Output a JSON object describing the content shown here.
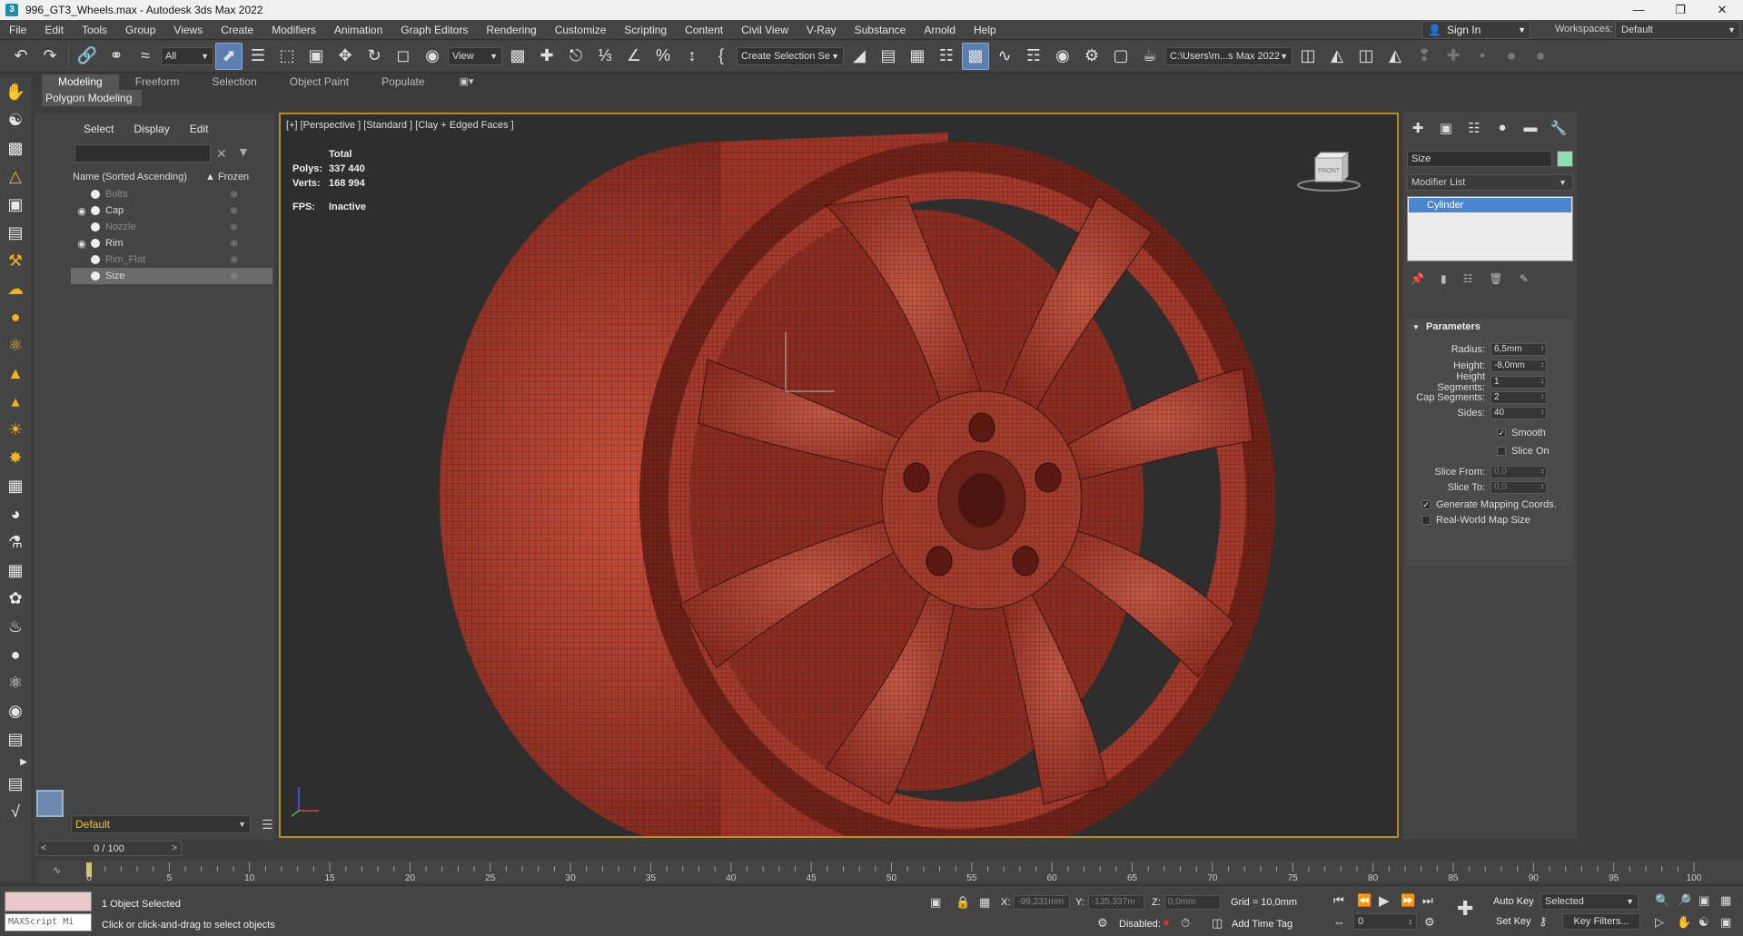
{
  "titlebar": {
    "title": "996_GT3_Wheels.max - Autodesk 3ds Max 2022",
    "app_icon": "3ds-max-icon"
  },
  "menu": [
    "File",
    "Edit",
    "Tools",
    "Group",
    "Views",
    "Create",
    "Modifiers",
    "Animation",
    "Graph Editors",
    "Rendering",
    "Customize",
    "Scripting",
    "Content",
    "Civil View",
    "V-Ray",
    "Substance",
    "Arnold",
    "Help"
  ],
  "account": {
    "sign_in": "Sign In",
    "workspaces_label": "Workspaces:",
    "workspace": "Default"
  },
  "toolbar": {
    "filter": "All",
    "coord_system": "View",
    "selection_set": "Create Selection Se",
    "project_path": "C:\\Users\\m...s Max 2022"
  },
  "ribbon": {
    "tabs": [
      "Modeling",
      "Freeform",
      "Selection",
      "Object Paint",
      "Populate"
    ],
    "active_tab": "Modeling",
    "sub_label": "Polygon Modeling"
  },
  "explorer": {
    "tabs": [
      "Select",
      "Display",
      "Edit"
    ],
    "search_value": "",
    "col_name": "Name (Sorted Ascending)",
    "col_frozen": "▲ Frozen",
    "rows": [
      {
        "name": "Bolts",
        "visible": false,
        "selected": false
      },
      {
        "name": "Cap",
        "visible": true,
        "selected": false
      },
      {
        "name": "Nozzle",
        "visible": false,
        "selected": false
      },
      {
        "name": "Rim",
        "visible": true,
        "selected": false
      },
      {
        "name": "Rim_Flat",
        "visible": false,
        "selected": false
      },
      {
        "name": "Size",
        "visible": false,
        "selected": true
      }
    ],
    "layer": "Default"
  },
  "viewport": {
    "label": "[+] [Perspective ] [Standard ] [Clay + Edged Faces ]",
    "stats_total": "Total",
    "polys_label": "Polys:",
    "polys": "337 440",
    "verts_label": "Verts:",
    "verts": "168 994",
    "fps_label": "FPS:",
    "fps": "Inactive",
    "viewcube_label": "FRONT",
    "wheel_color": "#b34535"
  },
  "command_panel": {
    "object_name": "Size",
    "object_color": "#8fe0b0",
    "modifier_list": "Modifier List",
    "stack": [
      "Cylinder"
    ],
    "rollout_title": "Parameters",
    "params": [
      {
        "label": "Radius:",
        "value": "6,5mm",
        "enabled": true
      },
      {
        "label": "Height:",
        "value": "-8,0mm",
        "enabled": true
      },
      {
        "label": "Height Segments:",
        "value": "1",
        "enabled": true
      },
      {
        "label": "Cap Segments:",
        "value": "2",
        "enabled": true
      },
      {
        "label": "Sides:",
        "value": "40",
        "enabled": true
      }
    ],
    "smooth": "Smooth",
    "slice_on": "Slice On",
    "slice_from_label": "Slice From:",
    "slice_from": "0,0",
    "slice_to_label": "Slice To:",
    "slice_to": "0,0",
    "gen_mapping": "Generate Mapping Coords.",
    "real_world": "Real-World Map Size"
  },
  "timeline": {
    "slider": "0 / 100",
    "ticks": [
      0,
      5,
      10,
      15,
      20,
      25,
      30,
      35,
      40,
      45,
      50,
      55,
      60,
      65,
      70,
      75,
      80,
      85,
      90,
      95,
      100
    ]
  },
  "status": {
    "maxscript": "MAXScript Mi",
    "selected": "1 Object Selected",
    "prompt": "Click or click-and-drag to select objects",
    "x_label": "X:",
    "x_value": "-99,231mm",
    "y_label": "Y:",
    "y_value": "-135,337m",
    "z_label": "Z:",
    "z_value": "0,0mm",
    "grid": "Grid = 10,0mm",
    "disabled_label": "Disabled:",
    "add_time_tag": "Add Time Tag",
    "frame": "0",
    "auto_key": "Auto Key",
    "key_mode": "Selected",
    "set_key": "Set Key",
    "key_filters": "Key Filters..."
  }
}
